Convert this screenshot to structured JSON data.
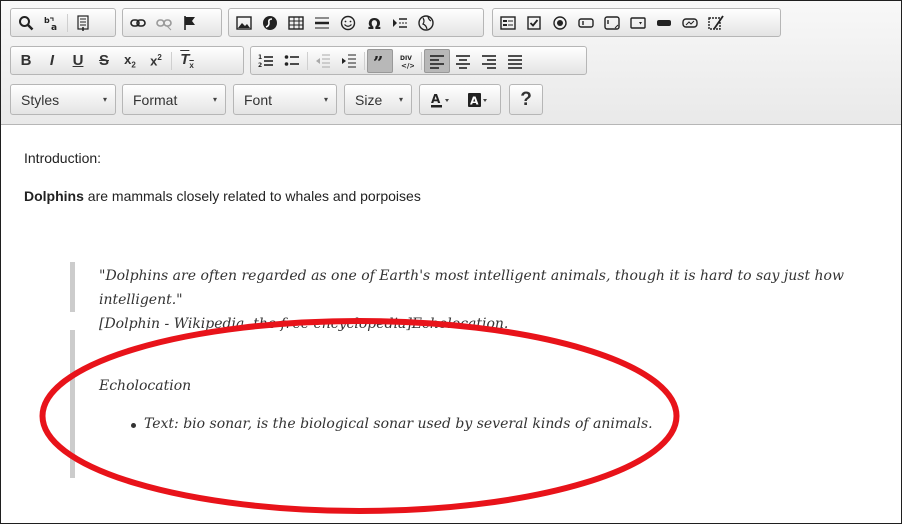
{
  "toolbar": {
    "combos": {
      "styles": "Styles",
      "format": "Format",
      "font": "Font",
      "size": "Size"
    },
    "help": "?",
    "dropdown_arrow": "▾"
  },
  "content": {
    "intro": "Introduction:",
    "para_bold": "Dolphins",
    "para_rest": " are mammals closely related to whales and porpoises",
    "quote_line1": "\"Dolphins are often regarded as one of Earth's most intelligent animals, though it is hard to say just how intelligent.\"",
    "quote_line2": "[Dolphin - Wikipedia, the free encyclopedia]Echolocation.",
    "echo_heading": "Echolocation",
    "echo_bullet": "Text: bio sonar, is the biological sonar used by several kinds of animals."
  },
  "colors": {
    "annotation": "#e8131a",
    "active_button": "#b8b8b8"
  }
}
